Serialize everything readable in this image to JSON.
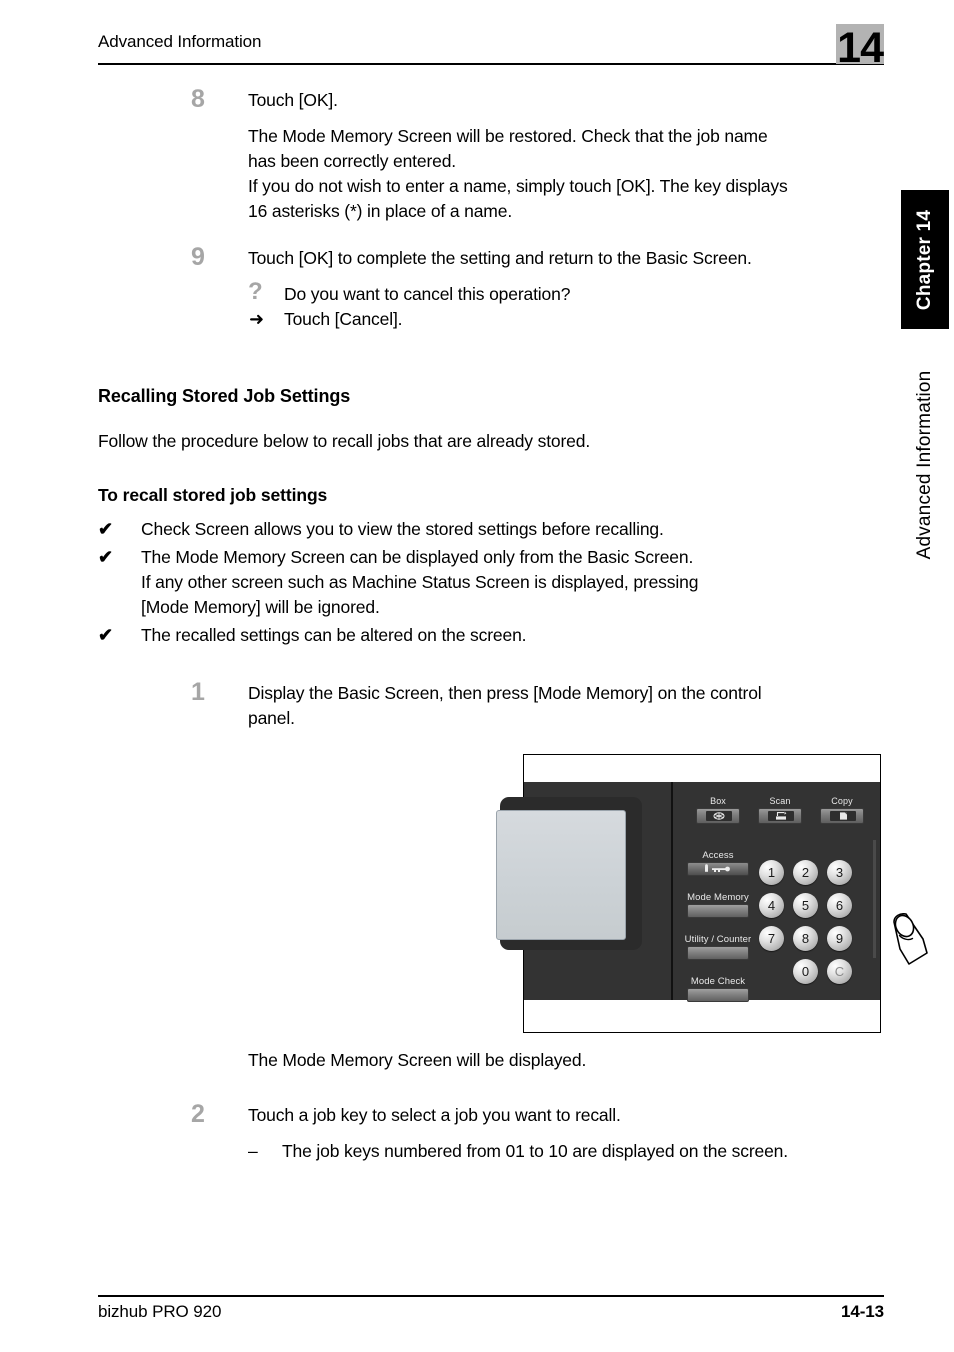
{
  "header": {
    "title": "Advanced Information",
    "chapter_number": "14"
  },
  "side_tab": {
    "chapter_label": "Chapter 14",
    "section_label": "Advanced Information"
  },
  "body": {
    "step8": {
      "number": "8",
      "title": "Touch [OK].",
      "para1_line1": "The Mode Memory Screen will be restored. Check that the job name",
      "para1_line2": "has been correctly entered.",
      "para1_line3": "If you do not wish to enter a name, simply touch [OK]. The key displays",
      "para1_line4": "16 asterisks (*) in place of a name."
    },
    "step9": {
      "number": "9",
      "title": "Touch [OK] to complete the setting and return to the Basic Screen.",
      "question_mark": "?",
      "question": "Do you want to cancel this operation?",
      "arrow": "➜",
      "answer": "Touch [Cancel]."
    },
    "heading_recalling": "Recalling Stored Job Settings",
    "intro_recalling": "Follow the procedure below to recall jobs that are already stored.",
    "heading_torecall": "To recall stored job settings",
    "check_mark": "✔",
    "checks": [
      {
        "line1": "Check Screen allows you to view the stored settings before recalling."
      },
      {
        "line1": "The Mode Memory Screen can be displayed only from the Basic Screen.",
        "line2": "If any other screen such as Machine Status Screen is displayed, pressing",
        "line3": "[Mode Memory] will be ignored."
      },
      {
        "line1": "The recalled settings can be altered on the screen."
      }
    ],
    "step1": {
      "number": "1",
      "line1": "Display the Basic Screen, then press [Mode Memory] on the control",
      "line2": "panel."
    },
    "after_figure": "The Mode Memory Screen will be displayed.",
    "step2": {
      "number": "2",
      "title": "Touch a job key to select a job you want to recall.",
      "dash": "–",
      "note": "The job keys numbered from 01 to 10 are displayed on the screen."
    }
  },
  "figure": {
    "mode_buttons": [
      {
        "label": "Box",
        "icon": "box-icon"
      },
      {
        "label": "Scan",
        "icon": "scan-icon"
      },
      {
        "label": "Copy",
        "icon": "copy-icon"
      }
    ],
    "left_keys": [
      {
        "label": "Access",
        "icon": "key-card-icon"
      },
      {
        "label": "Mode Memory",
        "icon": ""
      },
      {
        "label": "Utility / Counter",
        "icon": ""
      },
      {
        "label": "Mode Check",
        "icon": ""
      }
    ],
    "keypad": [
      [
        "1",
        "2",
        "3"
      ],
      [
        "4",
        "5",
        "6"
      ],
      [
        "7",
        "8",
        "9"
      ],
      [
        "0",
        "C"
      ]
    ],
    "pointer": "pointing-hand-icon"
  },
  "footer": {
    "product": "bizhub PRO 920",
    "page": "14-13"
  },
  "colors": {
    "step_number": "#a6a6a6",
    "chapter_box": "#b3b3b3",
    "side_tab": "#000000",
    "panel_body": "#333333",
    "lcd": "#ccd2d6"
  }
}
